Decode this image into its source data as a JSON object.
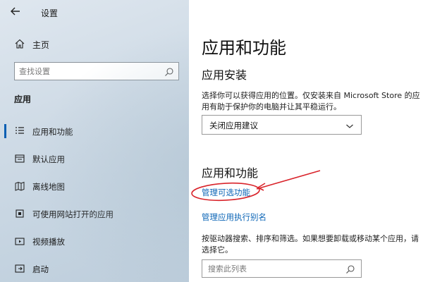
{
  "window": {
    "title": "设置",
    "back_icon": "back-arrow-icon"
  },
  "sidebar": {
    "home_label": "主页",
    "search_placeholder": "查找设置",
    "section_label": "应用",
    "items": [
      {
        "label": "应用和功能",
        "icon": "list-icon",
        "active": true
      },
      {
        "label": "默认应用",
        "icon": "default-apps-icon",
        "active": false
      },
      {
        "label": "离线地图",
        "icon": "map-icon",
        "active": false
      },
      {
        "label": "可使用网站打开的应用",
        "icon": "website-app-icon",
        "active": false
      },
      {
        "label": "视频播放",
        "icon": "video-icon",
        "active": false
      },
      {
        "label": "启动",
        "icon": "startup-icon",
        "active": false
      }
    ]
  },
  "main": {
    "title": "应用和功能",
    "install_heading": "应用安装",
    "install_desc": "选择你可以获得应用的位置。仅安装来自 Microsoft Store 的应用有助于保护你的电脑并让其平稳运行。",
    "install_dropdown_value": "关闭应用建议",
    "features_heading": "应用和功能",
    "manage_optional_link": "管理可选功能",
    "manage_alias_link": "管理应用执行别名",
    "sort_desc": "按驱动器搜索、排序和筛选。如果想要卸载或移动某个应用，请选择它。",
    "filter_placeholder": "搜索此列表"
  },
  "colors": {
    "accent": "#0a64b6",
    "annotation": "#d9232a"
  }
}
